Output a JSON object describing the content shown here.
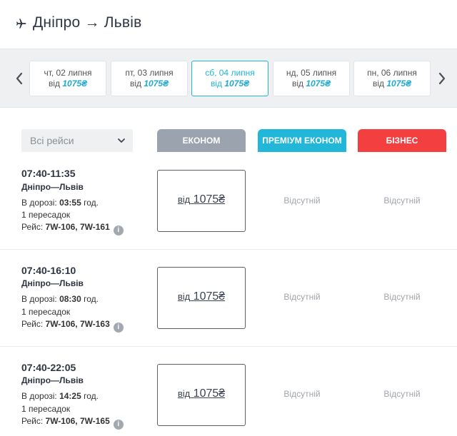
{
  "header": {
    "origin": "Дніпро",
    "arrow": "→",
    "destination": "Львів",
    "icon": "plane-icon"
  },
  "date_bar": {
    "prev_icon": "chevron-left-icon",
    "next_icon": "chevron-right-icon",
    "dates": [
      {
        "label": "чт, 02 липня",
        "from": "від",
        "price": "1075₴",
        "active": false
      },
      {
        "label": "пт, 03 липня",
        "from": "від",
        "price": "1075₴",
        "active": false
      },
      {
        "label": "сб, 04 липня",
        "from": "від",
        "price": "1075₴",
        "active": true
      },
      {
        "label": "нд, 05 липня",
        "from": "від",
        "price": "1075₴",
        "active": false
      },
      {
        "label": "пн, 06 липня",
        "from": "від",
        "price": "1075₴",
        "active": false
      }
    ]
  },
  "filter": {
    "selected": "Всі рейси",
    "icon": "chevron-down-icon"
  },
  "class_tabs": {
    "economy": "ЕКОНОМ",
    "premium": "ПРЕМІУМ ЕКОНОМ",
    "business": "БІЗНЕС",
    "colors": {
      "economy": "#9aa3ae",
      "premium": "#22b6d8",
      "business": "#f33f3f"
    }
  },
  "flights": [
    {
      "time": "07:40-11:35",
      "cities": "Дніпро—Львів",
      "duration_label": "В дорозі:",
      "duration": "03:55",
      "duration_unit": "год.",
      "stops": "1 пересадок",
      "flight_label": "Рейс:",
      "flight_numbers": "7W-106, 7W-161",
      "economy_from": "від",
      "economy_price": "1075₴",
      "premium": "Відсутній",
      "business": "Відсутній"
    },
    {
      "time": "07:40-16:10",
      "cities": "Дніпро—Львів",
      "duration_label": "В дорозі:",
      "duration": "08:30",
      "duration_unit": "год.",
      "stops": "1 пересадок",
      "flight_label": "Рейс:",
      "flight_numbers": "7W-106, 7W-163",
      "economy_from": "від",
      "economy_price": "1075₴",
      "premium": "Відсутній",
      "business": "Відсутній"
    },
    {
      "time": "07:40-22:05",
      "cities": "Дніпро—Львів",
      "duration_label": "В дорозі:",
      "duration": "14:25",
      "duration_unit": "год.",
      "stops": "1 пересадок",
      "flight_label": "Рейс:",
      "flight_numbers": "7W-106, 7W-165",
      "economy_from": "від",
      "economy_price": "1075₴",
      "premium": "Відсутній",
      "business": "Відсутній"
    }
  ],
  "info_glyph": "i"
}
